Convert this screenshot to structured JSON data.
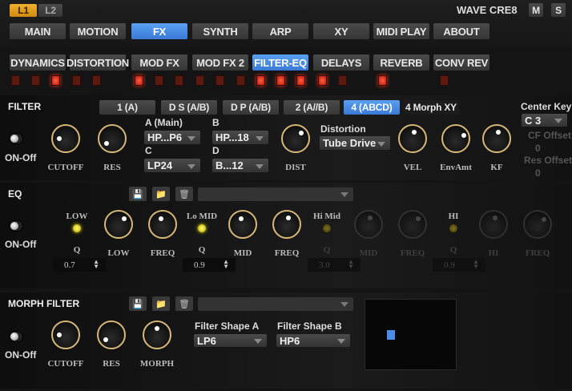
{
  "header": {
    "layers": [
      "L1",
      "L2"
    ],
    "active_layer": "L1",
    "title": "WAVE CRE8",
    "m_label": "M",
    "s_label": "S"
  },
  "main_tabs": [
    "MAIN",
    "MOTION",
    "FX",
    "SYNTH",
    "ARP",
    "XY",
    "MIDI PLAY",
    "ABOUT"
  ],
  "main_tab_active": "FX",
  "fx_tabs": [
    "DYNAMICS",
    "DISTORTION",
    "MOD FX",
    "MOD FX 2",
    "FILTER-EQ",
    "DELAYS",
    "REVERB",
    "CONV REV"
  ],
  "fx_tab_active": "FILTER-EQ",
  "fx_leds": [
    false,
    false,
    true,
    false,
    false,
    true,
    false,
    false,
    false,
    false,
    false,
    true,
    true,
    true,
    true,
    false,
    true,
    false
  ],
  "filter": {
    "title": "FILTER",
    "toggle_label": "ON-Off",
    "modes": [
      "1 (A)",
      "D S (A/B)",
      "D P (A/B)",
      "2 (A//B)",
      "4 (ABCD)",
      "4 Morph XY"
    ],
    "mode_active": "4 (ABCD)",
    "a_label": "A (Main)",
    "a_value": "HP...P6",
    "b_label": "B",
    "b_value": "HP...18",
    "c_label": "C",
    "c_value": "LP24",
    "d_label": "D",
    "d_value": "B...12",
    "distortion_label": "Distortion",
    "distortion_value": "Tube Drive",
    "center_key_label": "Center Key",
    "center_key_value": "C 3",
    "cf_offset_label": "CF Offset",
    "cf_offset_value": "0",
    "res_offset_label": "Res Offset",
    "res_offset_value": "0",
    "knobs": [
      {
        "label": "CUTOFF",
        "value": 0.2
      },
      {
        "label": "RES",
        "value": 0.08
      },
      {
        "label": "DIST",
        "value": 0.6
      },
      {
        "label": "VEL",
        "value": 0.5
      },
      {
        "label": "EnvAmt",
        "value": 0.7
      },
      {
        "label": "KF",
        "value": 0.5
      }
    ]
  },
  "eq": {
    "title": "EQ",
    "toggle_label": "ON-Off",
    "bands": [
      {
        "label": "LOW",
        "q_label": "Q",
        "q_value": "0.7",
        "enabled": true
      },
      {
        "label": "Lo MID",
        "q_label": "Q",
        "q_value": "0.9",
        "enabled": true
      },
      {
        "label": "Hi Mid",
        "q_label": "Q",
        "q_value": "3.0",
        "enabled": false
      },
      {
        "label": "HI",
        "q_label": "Q",
        "q_value": "0.9",
        "enabled": false
      }
    ],
    "knobs": [
      {
        "label": "LOW",
        "value": 0.6
      },
      {
        "label": "FREQ",
        "value": 0.42
      },
      {
        "label": "MID",
        "value": 0.42
      },
      {
        "label": "FREQ",
        "value": 0.5
      },
      {
        "label": "MID",
        "value": 0.5
      },
      {
        "label": "FREQ",
        "value": 0.6
      },
      {
        "label": "HI",
        "value": 0.5
      },
      {
        "label": "FREQ",
        "value": 0.65
      }
    ]
  },
  "morph": {
    "title": "MORPH FILTER",
    "toggle_label": "ON-Off",
    "shape_a_label": "Filter Shape A",
    "shape_a_value": "LP6",
    "shape_b_label": "Filter Shape B",
    "shape_b_value": "HP6",
    "knobs": [
      {
        "label": "CUTOFF",
        "value": 0.2
      },
      {
        "label": "RES",
        "value": 0.08
      },
      {
        "label": "MORPH",
        "value": 0.45
      }
    ]
  },
  "colors": {
    "accent": "#4a8de8",
    "knob_ring": "#d8b878",
    "led_on": "#ff3010",
    "eq_led": "#eeee40"
  }
}
